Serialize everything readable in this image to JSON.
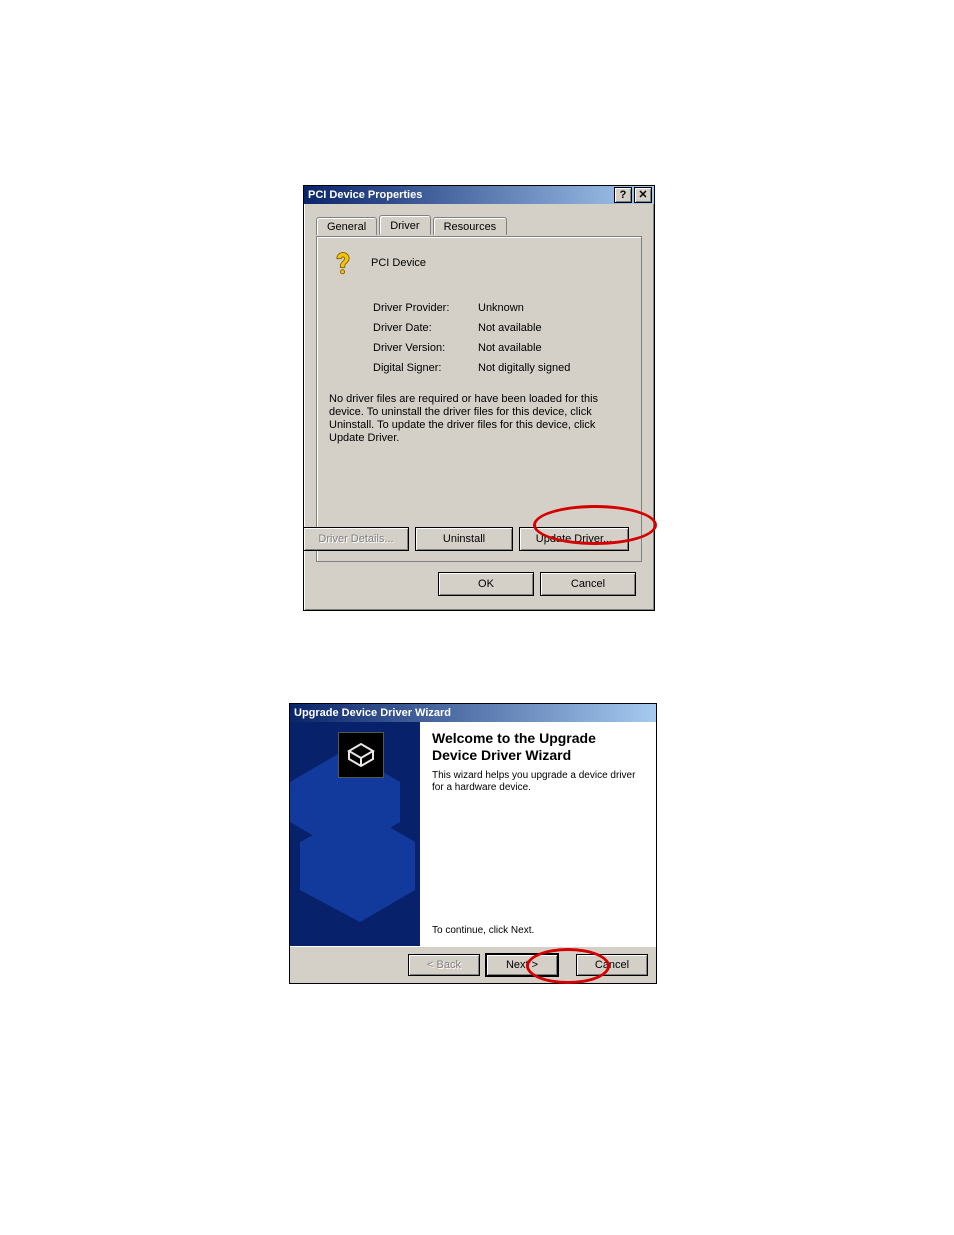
{
  "dialog1": {
    "title": "PCI Device Properties",
    "tabs": {
      "general": "General",
      "driver": "Driver",
      "resources": "Resources"
    },
    "device_name": "PCI Device",
    "rows": {
      "provider_label": "Driver Provider:",
      "provider_value": "Unknown",
      "date_label": "Driver Date:",
      "date_value": "Not available",
      "version_label": "Driver Version:",
      "version_value": "Not available",
      "signer_label": "Digital Signer:",
      "signer_value": "Not digitally signed"
    },
    "description": "No driver files are required or have been loaded for this device. To uninstall the driver files for this device, click Uninstall. To update the driver files for this device, click Update Driver.",
    "buttons": {
      "details": "Driver Details...",
      "uninstall": "Uninstall",
      "update": "Update Driver...",
      "ok": "OK",
      "cancel": "Cancel"
    },
    "title_buttons": {
      "help": "?",
      "close": "✕"
    }
  },
  "dialog2": {
    "title": "Upgrade Device Driver Wizard",
    "heading": "Welcome to the Upgrade Device Driver Wizard",
    "sub": "This wizard helps you upgrade a device driver for a hardware device.",
    "continue": "To continue, click Next.",
    "buttons": {
      "back": "< Back",
      "next": "Next >",
      "cancel": "Cancel"
    }
  }
}
